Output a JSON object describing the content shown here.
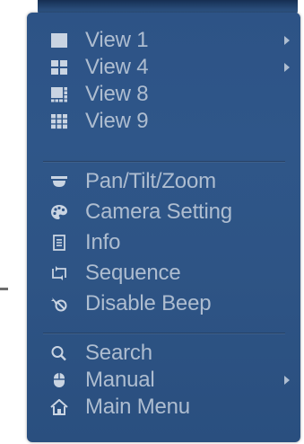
{
  "menu": {
    "items": [
      {
        "label": "View 1",
        "icon": "single-square-icon",
        "has_submenu": true
      },
      {
        "label": "View 4",
        "icon": "four-grid-icon",
        "has_submenu": true
      },
      {
        "label": "View 8",
        "icon": "eight-grid-icon",
        "has_submenu": false
      },
      {
        "label": "View 9",
        "icon": "nine-grid-icon",
        "has_submenu": false
      },
      {
        "label": "Pan/Tilt/Zoom",
        "icon": "ptz-camera-icon",
        "has_submenu": false
      },
      {
        "label": "Camera Setting",
        "icon": "palette-icon",
        "has_submenu": false
      },
      {
        "label": "Info",
        "icon": "info-document-icon",
        "has_submenu": false
      },
      {
        "label": "Sequence",
        "icon": "sequence-cycle-icon",
        "has_submenu": false
      },
      {
        "label": "Disable Beep",
        "icon": "mute-speaker-icon",
        "has_submenu": false
      },
      {
        "label": "Search",
        "icon": "search-icon",
        "has_submenu": false
      },
      {
        "label": "Manual",
        "icon": "mouse-icon",
        "has_submenu": true
      },
      {
        "label": "Main Menu",
        "icon": "home-icon",
        "has_submenu": false
      }
    ]
  },
  "colors": {
    "menu_background": "#2e5487",
    "text": "#aebdd0",
    "icon": "#c9d4e2"
  }
}
